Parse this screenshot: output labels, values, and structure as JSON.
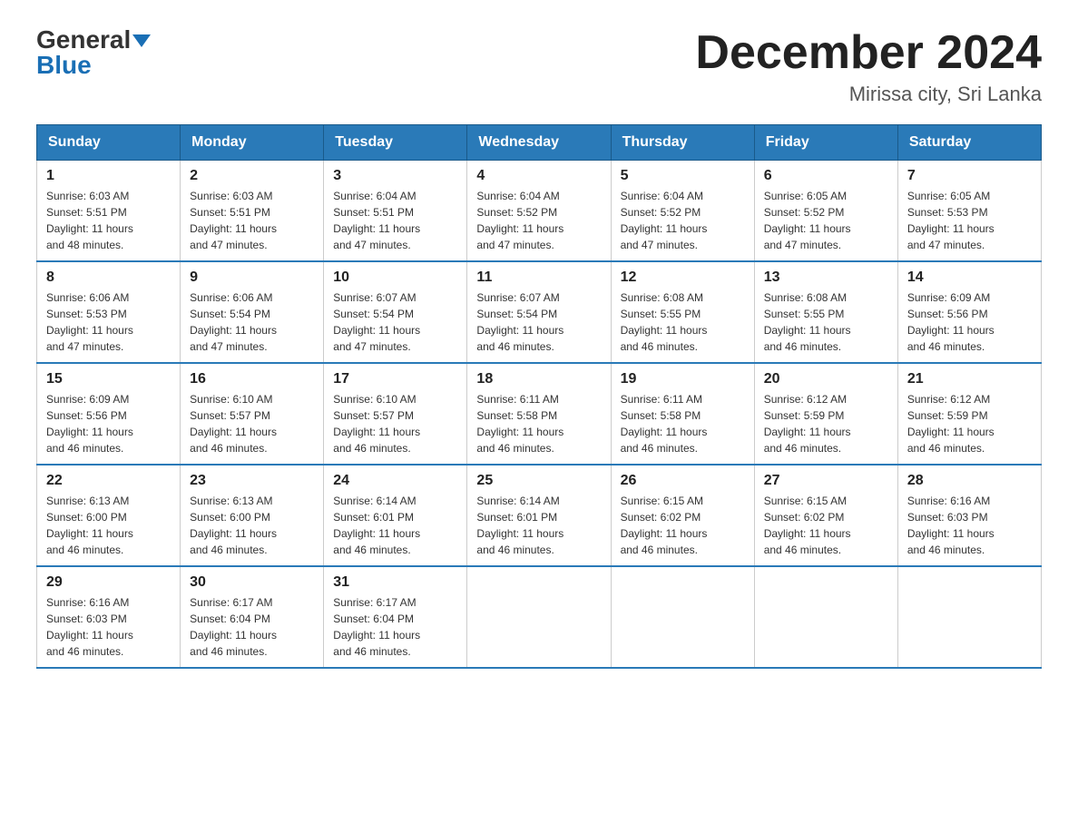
{
  "logo": {
    "general": "General",
    "blue": "Blue"
  },
  "header": {
    "month_year": "December 2024",
    "location": "Mirissa city, Sri Lanka"
  },
  "weekdays": [
    "Sunday",
    "Monday",
    "Tuesday",
    "Wednesday",
    "Thursday",
    "Friday",
    "Saturday"
  ],
  "weeks": [
    [
      {
        "day": "1",
        "sunrise": "6:03 AM",
        "sunset": "5:51 PM",
        "daylight": "11 hours and 48 minutes."
      },
      {
        "day": "2",
        "sunrise": "6:03 AM",
        "sunset": "5:51 PM",
        "daylight": "11 hours and 47 minutes."
      },
      {
        "day": "3",
        "sunrise": "6:04 AM",
        "sunset": "5:51 PM",
        "daylight": "11 hours and 47 minutes."
      },
      {
        "day": "4",
        "sunrise": "6:04 AM",
        "sunset": "5:52 PM",
        "daylight": "11 hours and 47 minutes."
      },
      {
        "day": "5",
        "sunrise": "6:04 AM",
        "sunset": "5:52 PM",
        "daylight": "11 hours and 47 minutes."
      },
      {
        "day": "6",
        "sunrise": "6:05 AM",
        "sunset": "5:52 PM",
        "daylight": "11 hours and 47 minutes."
      },
      {
        "day": "7",
        "sunrise": "6:05 AM",
        "sunset": "5:53 PM",
        "daylight": "11 hours and 47 minutes."
      }
    ],
    [
      {
        "day": "8",
        "sunrise": "6:06 AM",
        "sunset": "5:53 PM",
        "daylight": "11 hours and 47 minutes."
      },
      {
        "day": "9",
        "sunrise": "6:06 AM",
        "sunset": "5:54 PM",
        "daylight": "11 hours and 47 minutes."
      },
      {
        "day": "10",
        "sunrise": "6:07 AM",
        "sunset": "5:54 PM",
        "daylight": "11 hours and 47 minutes."
      },
      {
        "day": "11",
        "sunrise": "6:07 AM",
        "sunset": "5:54 PM",
        "daylight": "11 hours and 46 minutes."
      },
      {
        "day": "12",
        "sunrise": "6:08 AM",
        "sunset": "5:55 PM",
        "daylight": "11 hours and 46 minutes."
      },
      {
        "day": "13",
        "sunrise": "6:08 AM",
        "sunset": "5:55 PM",
        "daylight": "11 hours and 46 minutes."
      },
      {
        "day": "14",
        "sunrise": "6:09 AM",
        "sunset": "5:56 PM",
        "daylight": "11 hours and 46 minutes."
      }
    ],
    [
      {
        "day": "15",
        "sunrise": "6:09 AM",
        "sunset": "5:56 PM",
        "daylight": "11 hours and 46 minutes."
      },
      {
        "day": "16",
        "sunrise": "6:10 AM",
        "sunset": "5:57 PM",
        "daylight": "11 hours and 46 minutes."
      },
      {
        "day": "17",
        "sunrise": "6:10 AM",
        "sunset": "5:57 PM",
        "daylight": "11 hours and 46 minutes."
      },
      {
        "day": "18",
        "sunrise": "6:11 AM",
        "sunset": "5:58 PM",
        "daylight": "11 hours and 46 minutes."
      },
      {
        "day": "19",
        "sunrise": "6:11 AM",
        "sunset": "5:58 PM",
        "daylight": "11 hours and 46 minutes."
      },
      {
        "day": "20",
        "sunrise": "6:12 AM",
        "sunset": "5:59 PM",
        "daylight": "11 hours and 46 minutes."
      },
      {
        "day": "21",
        "sunrise": "6:12 AM",
        "sunset": "5:59 PM",
        "daylight": "11 hours and 46 minutes."
      }
    ],
    [
      {
        "day": "22",
        "sunrise": "6:13 AM",
        "sunset": "6:00 PM",
        "daylight": "11 hours and 46 minutes."
      },
      {
        "day": "23",
        "sunrise": "6:13 AM",
        "sunset": "6:00 PM",
        "daylight": "11 hours and 46 minutes."
      },
      {
        "day": "24",
        "sunrise": "6:14 AM",
        "sunset": "6:01 PM",
        "daylight": "11 hours and 46 minutes."
      },
      {
        "day": "25",
        "sunrise": "6:14 AM",
        "sunset": "6:01 PM",
        "daylight": "11 hours and 46 minutes."
      },
      {
        "day": "26",
        "sunrise": "6:15 AM",
        "sunset": "6:02 PM",
        "daylight": "11 hours and 46 minutes."
      },
      {
        "day": "27",
        "sunrise": "6:15 AM",
        "sunset": "6:02 PM",
        "daylight": "11 hours and 46 minutes."
      },
      {
        "day": "28",
        "sunrise": "6:16 AM",
        "sunset": "6:03 PM",
        "daylight": "11 hours and 46 minutes."
      }
    ],
    [
      {
        "day": "29",
        "sunrise": "6:16 AM",
        "sunset": "6:03 PM",
        "daylight": "11 hours and 46 minutes."
      },
      {
        "day": "30",
        "sunrise": "6:17 AM",
        "sunset": "6:04 PM",
        "daylight": "11 hours and 46 minutes."
      },
      {
        "day": "31",
        "sunrise": "6:17 AM",
        "sunset": "6:04 PM",
        "daylight": "11 hours and 46 minutes."
      },
      null,
      null,
      null,
      null
    ]
  ],
  "labels": {
    "sunrise": "Sunrise:",
    "sunset": "Sunset:",
    "daylight": "Daylight:"
  }
}
